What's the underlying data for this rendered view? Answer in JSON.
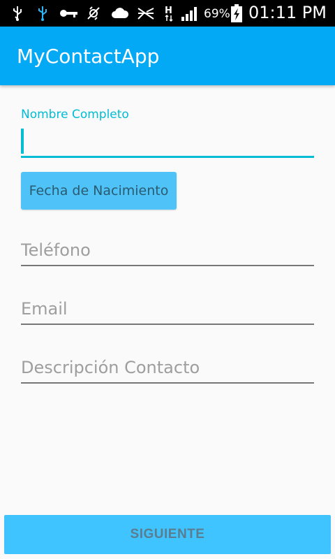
{
  "status_bar": {
    "battery_percent": "69%",
    "time": "01:11 PM",
    "icons": [
      "usb-icon",
      "usb-debug-icon",
      "key-icon",
      "data-saver-icon",
      "cloud-icon",
      "no-signal-icon",
      "hspa-icon",
      "signal-icon",
      "battery-charging-icon"
    ]
  },
  "app_bar": {
    "title": "MyContactApp"
  },
  "form": {
    "name_label": "Nombre Completo",
    "name_value": "",
    "date_button": "Fecha de Nacimiento",
    "phone_placeholder": "Teléfono",
    "email_placeholder": "Email",
    "description_placeholder": "Descripción Contacto"
  },
  "actions": {
    "next_button": "SIGUIENTE"
  },
  "colors": {
    "primary": "#03a9f4",
    "accent": "#00bcd4",
    "button": "#4fc3f7",
    "background": "#fafafa"
  }
}
